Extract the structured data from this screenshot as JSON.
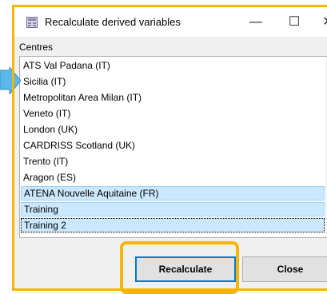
{
  "window": {
    "title": "Recalculate derived variables"
  },
  "controls": {
    "minimize": "—",
    "maximize": "☐",
    "close": "✕"
  },
  "group_label": "Centres",
  "centres": [
    {
      "label": "ATS Val Padana (IT)",
      "selected": false
    },
    {
      "label": "Sicilia (IT)",
      "selected": false
    },
    {
      "label": "Metropolitan Area Milan (IT)",
      "selected": false
    },
    {
      "label": "Veneto (IT)",
      "selected": false
    },
    {
      "label": "London (UK)",
      "selected": false
    },
    {
      "label": "CARDRISS Scotland (UK)",
      "selected": false
    },
    {
      "label": "Trento (IT)",
      "selected": false
    },
    {
      "label": "Aragon (ES)",
      "selected": false
    },
    {
      "label": "ATENA Nouvelle Aquitaine (FR)",
      "selected": true
    },
    {
      "label": "Training",
      "selected": true
    },
    {
      "label": "Training 2",
      "selected": true
    }
  ],
  "buttons": {
    "recalculate": "Recalculate",
    "close": "Close"
  },
  "colors": {
    "highlight": "#f6b500",
    "selection": "#cce8ff",
    "arrow": "#5bb8ec"
  }
}
